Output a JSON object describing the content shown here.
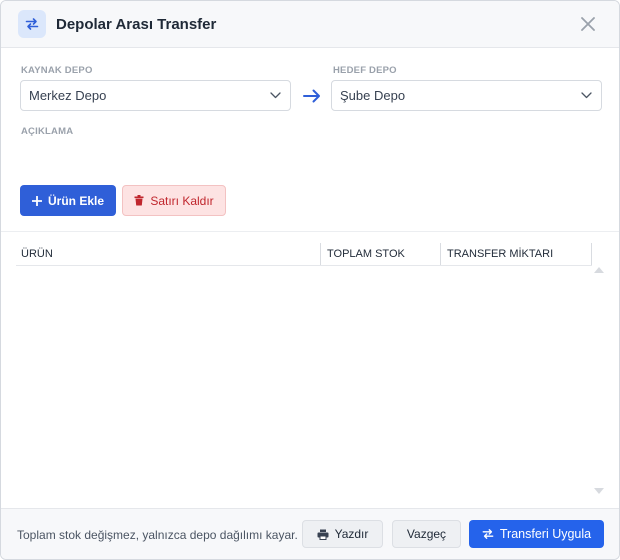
{
  "dialog": {
    "title": "Depolar Arası Transfer",
    "header_icon": "swap-arrows-icon",
    "close_icon": "close-icon"
  },
  "form": {
    "source_label": "KAYNAK DEPO",
    "source_value": "Merkez Depo",
    "target_label": "HEDEF DEPO",
    "target_value": "Şube Depo",
    "description_label": "AÇIKLAMA"
  },
  "actions": {
    "add_product": "Ürün Ekle",
    "remove_row": "Satırı Kaldır"
  },
  "table": {
    "columns": [
      "ÜRÜN",
      "TOPLAM STOK",
      "TRANSFER MİKTARI"
    ],
    "rows": []
  },
  "footer": {
    "note": "Toplam stok değişmez, yalnızca depo dağılımı kayar.",
    "print": "Yazdır",
    "cancel": "Vazgeç",
    "apply": "Transferi Uygula"
  },
  "colors": {
    "primary": "#2f5fd8",
    "apply": "#2563eb",
    "danger_bg": "#fde3e3",
    "danger_text": "#c0262d"
  }
}
